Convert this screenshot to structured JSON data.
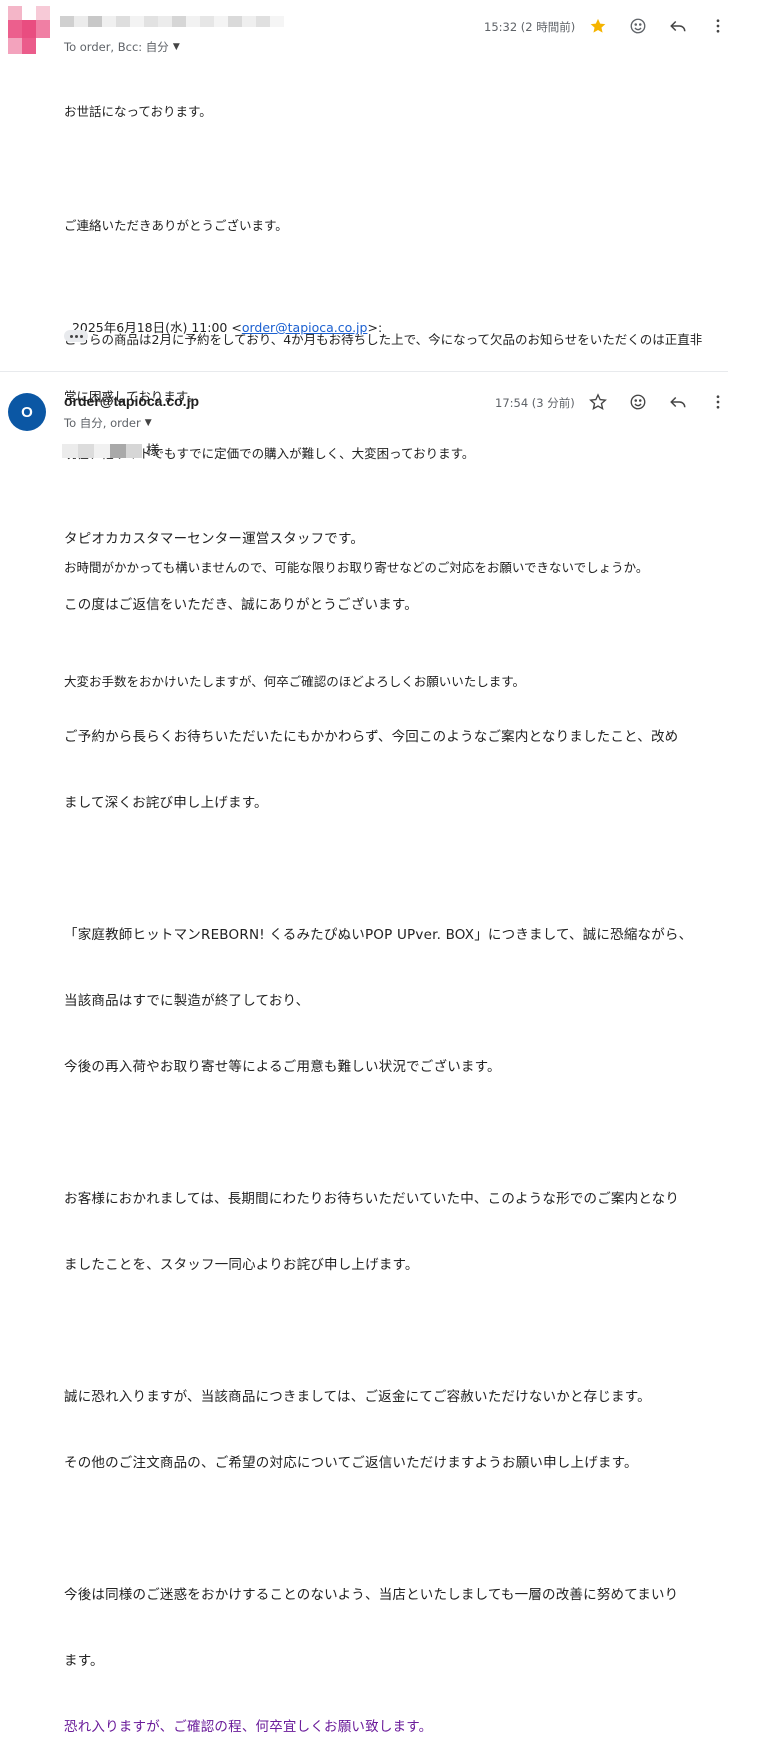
{
  "message1": {
    "recipients": "To order, Bcc: 自分",
    "time": "15:32 (2 時間前)",
    "body_lines": [
      "お世話になっております。",
      "",
      "ご連絡いただきありがとうございます。",
      "",
      "こちらの商品は2月に予約をしており、4か月もお待ちした上で、今になって欠品のお知らせをいただくのは正直非",
      "常に困惑しております。",
      "現在、他サイトでもすでに定価での購入が難しく、大変困っております。",
      "",
      "お時間がかかっても構いませんので、可能な限りお取り寄せなどのご対応をお願いできないでしょうか。",
      "",
      "大変お手数をおかけいたしますが、何卒ご確認のほどよろしくお願いいたします。"
    ],
    "quote_prefix": "2025年6月18日(水) 11:00 <",
    "quote_email": "order@tapioca.co.jp",
    "quote_suffix": ">:",
    "icons": {
      "star": "star-filled-icon",
      "emoji": "emoji-icon",
      "reply": "reply-icon",
      "more": "more-vert-icon"
    },
    "star_color": "#f5b400"
  },
  "message2": {
    "avatar_letter": "O",
    "avatar_color": "#0b57a4",
    "sender": "order@tapioca.co.jp",
    "recipients": "To 自分, order",
    "time": "17:54 (3 分前)",
    "salutation_suffix": "様",
    "body_lines": [
      "タピオカカスタマーセンター運営スタッフです。",
      "この度はご返信をいただき、誠にありがとうございます。",
      "",
      "ご予約から長らくお待ちいただいたにもかかわらず、今回このようなご案内となりましたこと、改め",
      "まして深くお詫び申し上げます。",
      "",
      "「家庭教師ヒットマンREBORN! くるみたぴぬいPOP UPver. BOX」につきまして、誠に恐縮ながら、",
      "当該商品はすでに製造が終了しており、",
      "今後の再入荷やお取り寄せ等によるご用意も難しい状況でございます。",
      "",
      "お客様におかれましては、長期間にわたりお待ちいただいていた中、このような形でのご案内となり",
      "ましたことを、スタッフ一同心よりお詫び申し上げます。",
      "",
      "誠に恐れ入りますが、当該商品につきましては、ご返金にてご容赦いただけないかと存じます。",
      "その他のご注文商品の、ご希望の対応についてご返信いただけますようお願い申し上げます。",
      "",
      "今後は同様のご迷惑をおかけすることのないよう、当店といたしましても一層の改善に努めてまいり",
      "ます。"
    ],
    "closing_line": "恐れ入りますが、ご確認の程、何卒宜しくお願い致します。",
    "closing_color": "#6a1b9a"
  }
}
